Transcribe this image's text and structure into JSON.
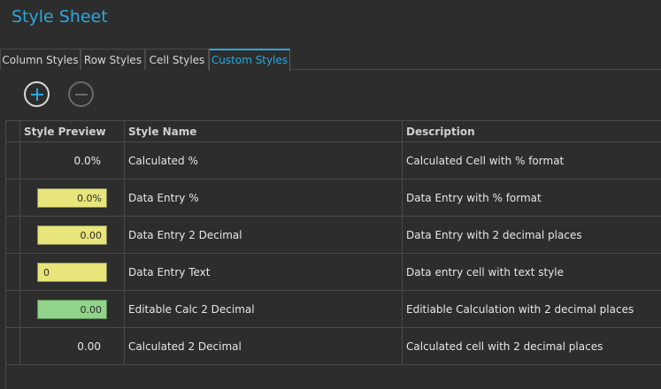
{
  "window": {
    "title": "Style Sheet"
  },
  "tabs": [
    {
      "label": "Column Styles",
      "active": false
    },
    {
      "label": "Row Styles",
      "active": false
    },
    {
      "label": "Cell Styles",
      "active": false
    },
    {
      "label": "Custom Styles",
      "active": true
    }
  ],
  "toolbar": {
    "add_icon": "plus-circle-icon",
    "remove_icon": "minus-circle-icon"
  },
  "grid": {
    "headers": {
      "preview": "Style Preview",
      "name": "Style Name",
      "description": "Description"
    },
    "rows": [
      {
        "preview": "0.0%",
        "preview_fill": "",
        "name": "Calculated %",
        "description": "Calculated Cell with % format"
      },
      {
        "preview": "0.0%",
        "preview_fill": "#e8e57a",
        "name": "Data Entry %",
        "description": "Data Entry with % format"
      },
      {
        "preview": "0.00",
        "preview_fill": "#e8e57a",
        "name": "Data Entry 2 Decimal",
        "description": "Data Entry with 2 decimal places"
      },
      {
        "preview": "0",
        "preview_fill": "#e8e57a",
        "name": "Data Entry Text",
        "description": "Data entry cell with text style"
      },
      {
        "preview": "0.00",
        "preview_fill": "#8fd48a",
        "name": "Editable Calc 2 Decimal",
        "description": "Editiable Calculation with 2 decimal places"
      },
      {
        "preview": "0.00",
        "preview_fill": "",
        "name": "Calculated 2 Decimal",
        "description": "Calculated cell with 2 decimal places"
      }
    ]
  },
  "colors": {
    "accent": "#29a9e0",
    "background": "#2d2d2d",
    "grid_line": "#4a4a4a"
  }
}
